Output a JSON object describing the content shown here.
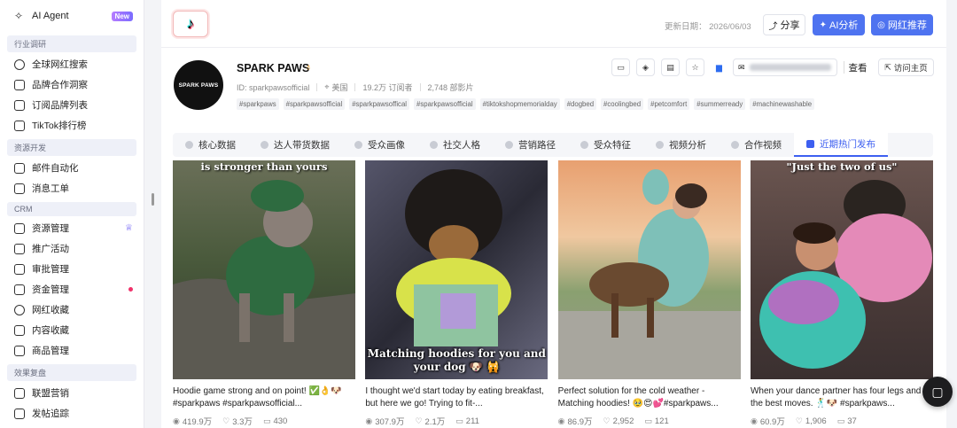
{
  "sidebar": {
    "top": {
      "label": "AI Agent",
      "badge": "New"
    },
    "groups": [
      {
        "title": "行业调研",
        "items": [
          {
            "label": "全球网红搜索"
          },
          {
            "label": "品牌合作洞察"
          },
          {
            "label": "订阅品牌列表"
          },
          {
            "label": "TikTok排行榜"
          }
        ]
      },
      {
        "title": "资源开发",
        "items": [
          {
            "label": "邮件自动化"
          },
          {
            "label": "消息工单"
          }
        ]
      },
      {
        "title": "CRM",
        "items": [
          {
            "label": "资源管理"
          },
          {
            "label": "推广活动"
          },
          {
            "label": "审批管理"
          },
          {
            "label": "资金管理"
          },
          {
            "label": "网红收藏"
          },
          {
            "label": "内容收藏"
          },
          {
            "label": "商品管理"
          }
        ]
      },
      {
        "title": "效果复盘",
        "items": [
          {
            "label": "联盟营销"
          },
          {
            "label": "发帖追踪"
          }
        ]
      }
    ]
  },
  "header": {
    "update_date": "更新日期： 2026/06/03",
    "share_label": "分享",
    "ai_label": "AI分析",
    "recommend_label": "网红推荐"
  },
  "profile": {
    "avatar_text": "SPARK PAWS",
    "name": "SPARK PAWS",
    "id": "ID: sparkpawsofficial",
    "country": "美国",
    "subscribers": "19.2万 订阅者",
    "videos": "2,748 部影片",
    "tags": [
      "#sparkpaws",
      "#sparkpawsofficial",
      "#sparkpawsoffical",
      "#sparkpawsofficial",
      "#tiktokshopmemorialday",
      "#dogbed",
      "#coolingbed",
      "#petcomfort",
      "#summerready",
      "#machinewashable"
    ],
    "view_label": "查看",
    "visit_label": "访问主页"
  },
  "tabs": [
    {
      "label": "核心数据"
    },
    {
      "label": "达人带货数据"
    },
    {
      "label": "受众画像"
    },
    {
      "label": "社交人格"
    },
    {
      "label": "营销路径"
    },
    {
      "label": "受众特征"
    },
    {
      "label": "视频分析"
    },
    {
      "label": "合作视频"
    },
    {
      "label": "近期热门发布"
    }
  ],
  "videos": [
    {
      "cap_top": "is stronger than yours",
      "cap_bot": "",
      "desc": "Hoodie game strong and on point! ✅👌🐶 #sparkpaws #sparkpawsofficial...",
      "views": "419.9万",
      "likes": "3.3万",
      "comments": "430",
      "bg": "#4a5a3c"
    },
    {
      "cap_top": "",
      "cap_bot": "Matching hoodies for you and your dog 🐶 🙀",
      "desc": "I thought we'd start today by eating breakfast, but here we go! Trying to fit-...",
      "views": "307.9万",
      "likes": "2.1万",
      "comments": "211",
      "bg": "#3b3b45"
    },
    {
      "cap_top": "",
      "cap_bot": "",
      "desc": "Perfect solution for the cold weather - Matching hoodies! 🥹😍💕#sparkpaws...",
      "views": "86.9万",
      "likes": "2,952",
      "comments": "121",
      "bg": "#9aa89a"
    },
    {
      "cap_top": "\"Just the two of us\"",
      "cap_bot": "",
      "desc": "When your dance partner has four legs and the best moves. 🕺🐶 #sparkpaws...",
      "views": "60.9万",
      "likes": "1,906",
      "comments": "37",
      "bg": "#5a4a4a"
    }
  ]
}
